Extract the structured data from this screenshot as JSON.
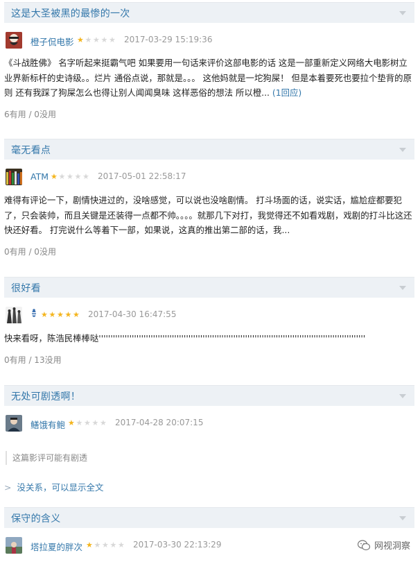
{
  "reviews": [
    {
      "title": "这是大圣被黑的最惨的一次",
      "author": "橙子侃电影",
      "rating": 1,
      "time": "2017-03-29 15:19:36",
      "text": "《斗战胜佛》 名字听起来挺霸气吧 如果要用一句话来评价这部电影的话 这是一部重新定义网络大电影树立业界新标杆的史诗级。。烂片 通俗点说，那就是。。。 这他妈就是一坨狗屎！ 但是本着要死也要拉个垫背的原则 还有我踩了狗屎怎么也得让别人闻闻臭味 这样恶俗的想法 所以橙...",
      "reply": "(1回应)",
      "votes": "6有用 / 0没用"
    },
    {
      "title": "毫无看点",
      "author": "ATM",
      "rating": 1,
      "time": "2017-05-01 22:58:17",
      "text": "难得有评论一下，剧情快进过的，没啥感觉，可以说也没啥剧情。 打斗场面的话，说实话，尴尬症都要犯了，只会装帅，而且关键是还装得一点都不帅。。。。就那几下对打，我觉得还不如看戏剧，戏剧的打斗比这还快还好看。 打完说什么等着下一部，如果说，这真的推出第二部的话，我...",
      "votes": "0有用 / 0没用"
    },
    {
      "title": "很好看",
      "author": "",
      "author_icon": "bee-icon",
      "rating": 5,
      "time": "2017-04-30 16:47:55",
      "text": "快来看呀，陈浩民棒棒哒''''''''''''''''''''''''''''''''''''''''''''''''''''''''''''''''''''''''''''''''''''''''''''''''''''''''''''''''''...",
      "votes": "0有用 / 13没用"
    },
    {
      "title": "无处可剧透啊！",
      "author": "鳝饿有鲍",
      "rating": 1,
      "time": "2017-04-28 20:07:15",
      "spoiler_note": "这篇影评可能有剧透",
      "show_all": "没关系，可以显示全文"
    },
    {
      "title": "保守的含义",
      "author": "塔拉夏的胖次",
      "rating": 1,
      "time": "2017-03-30 22:13:29"
    }
  ],
  "watermark": "网视洞察",
  "colors": {
    "link": "#3377aa",
    "star": "#f4b51e",
    "title_bg": "#edf1f5"
  }
}
